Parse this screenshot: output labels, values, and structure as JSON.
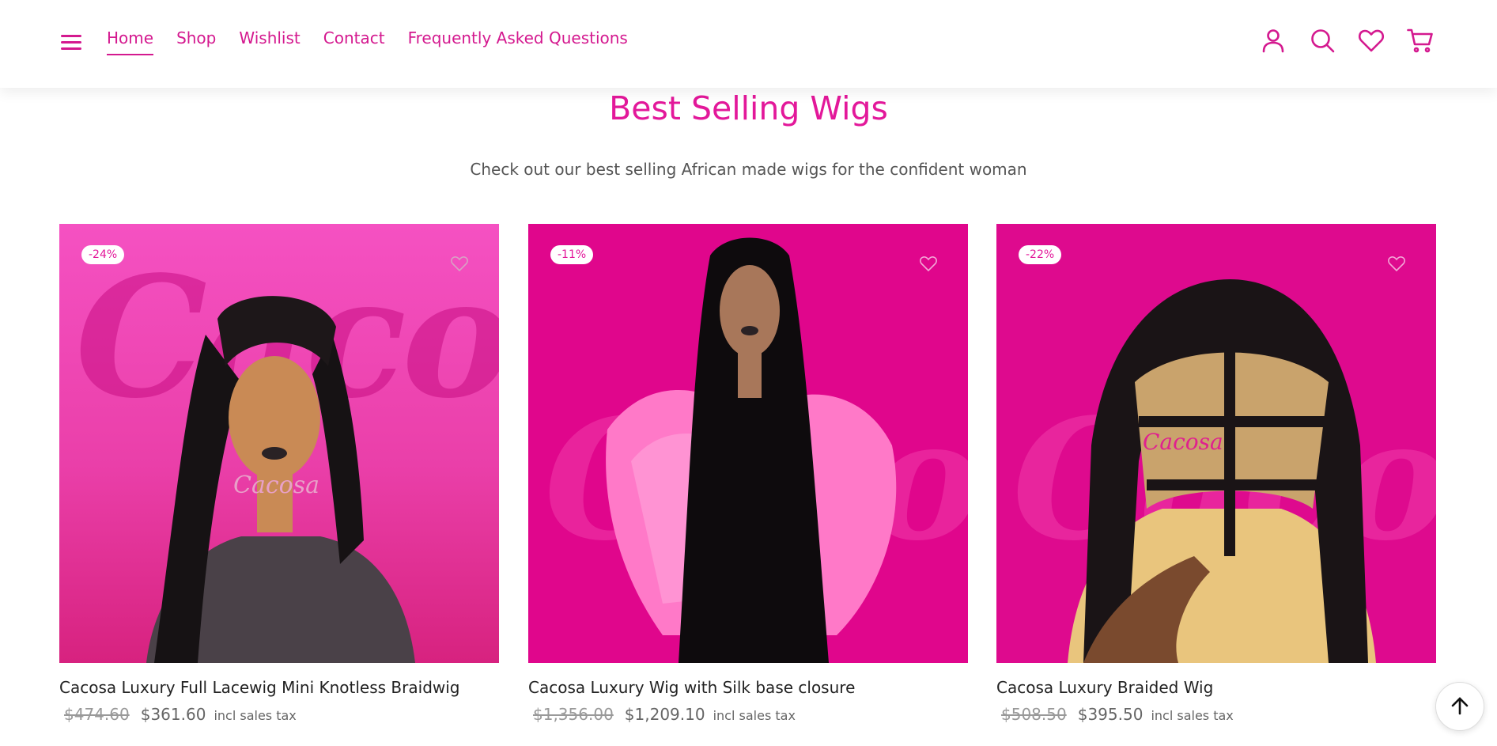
{
  "nav": {
    "items": [
      {
        "label": "Home",
        "active": true
      },
      {
        "label": "Shop",
        "active": false
      },
      {
        "label": "Wishlist",
        "active": false
      },
      {
        "label": "Contact",
        "active": false
      },
      {
        "label": "Frequently Asked Questions",
        "active": false
      }
    ],
    "icons": [
      "menu-icon",
      "account-icon",
      "search-icon",
      "heart-icon",
      "cart-icon"
    ]
  },
  "section": {
    "title": "Best Selling Wigs",
    "subtitle": "Check out our best selling  African made wigs for the confident woman"
  },
  "products": [
    {
      "badge": "-24%",
      "name": "Cacosa Luxury Full Lacewig Mini Knotless Braidwig",
      "old_price": "$474.60",
      "price": "$361.60",
      "tax": "incl sales tax",
      "watermark": "Cacosa"
    },
    {
      "badge": "-11%",
      "name": "Cacosa Luxury Wig with Silk base closure",
      "old_price": "$1,356.00",
      "price": "$1,209.10",
      "tax": "incl sales tax",
      "watermark": "Cacosa"
    },
    {
      "badge": "-22%",
      "name": "Cacosa Luxury Braided Wig",
      "old_price": "$508.50",
      "price": "$395.50",
      "tax": "incl sales tax",
      "watermark": "Cacosa"
    }
  ],
  "colors": {
    "accent": "#e3189a",
    "nav": "#d4198f",
    "card1_bg": "#f04fb8",
    "card2_bg": "#e0068c",
    "card3_bg": "#de0a8e"
  }
}
